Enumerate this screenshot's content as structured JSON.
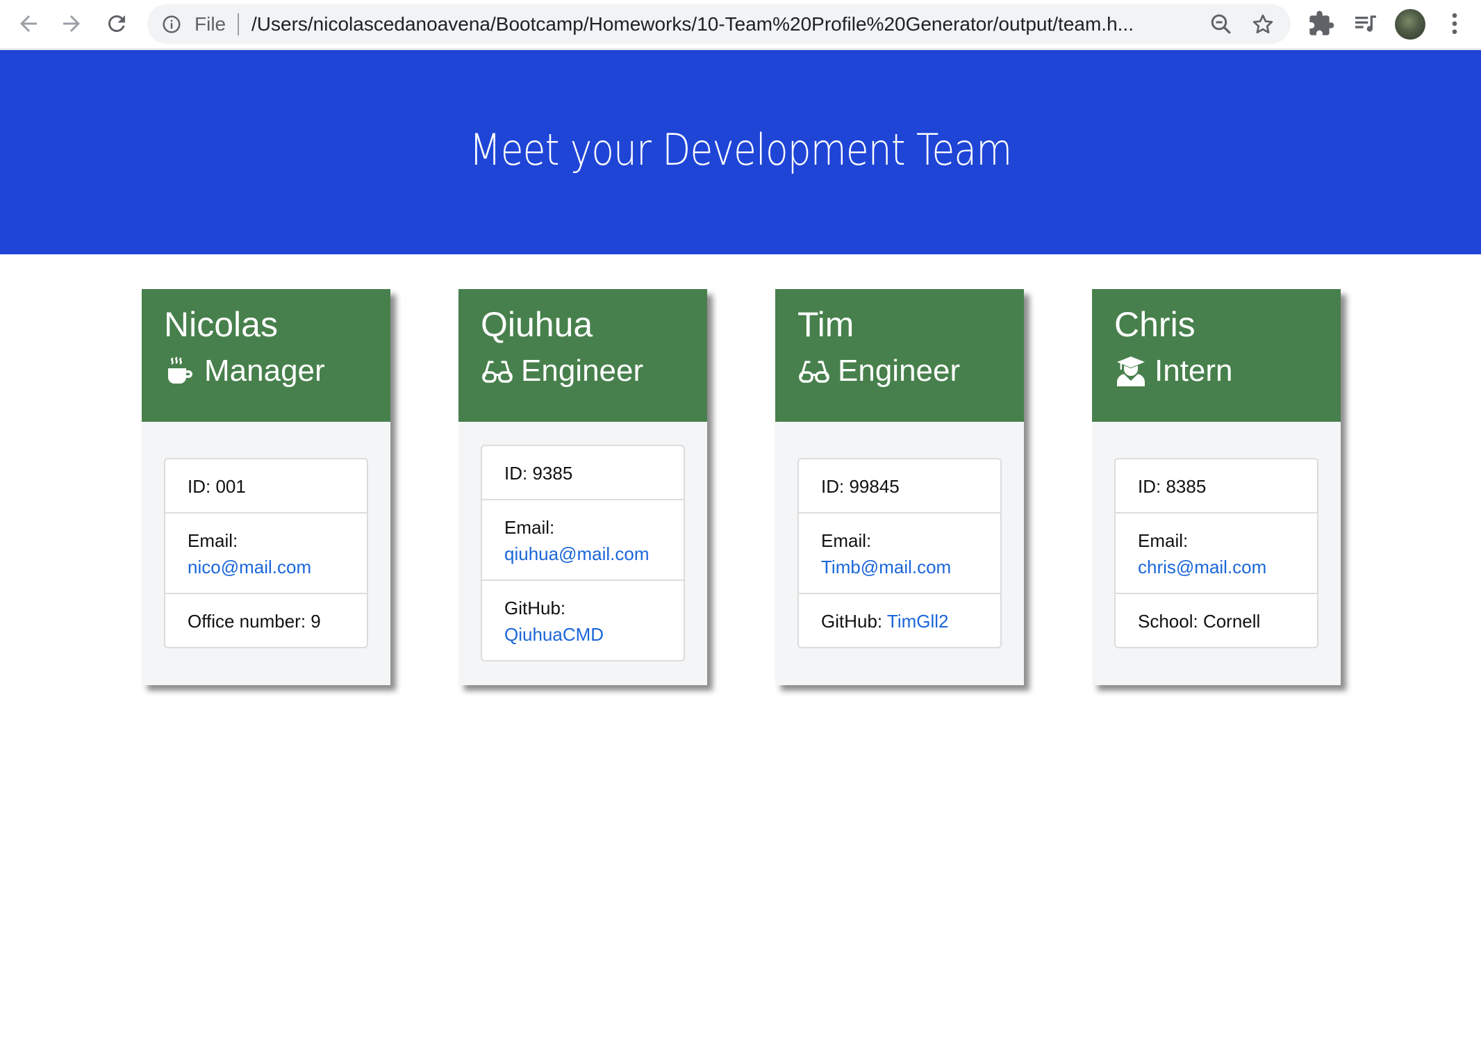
{
  "browser": {
    "scheme_label": "File",
    "url": "/Users/nicolascedanoavena/Bootcamp/Homeworks/10-Team%20Profile%20Generator/output/team.h..."
  },
  "page": {
    "title": "Meet your Development Team",
    "header_color": "#1f45d6",
    "card_header_color": "#47804c",
    "link_color": "#1a66d9"
  },
  "team": [
    {
      "name": "Nicolas",
      "role": "Manager",
      "icon": "coffee-icon",
      "id_text": "ID: 001",
      "email_label": "Email:",
      "email": "nico@mail.com",
      "extra_label": "Office number: 9",
      "extra_value": ""
    },
    {
      "name": "Qiuhua",
      "role": "Engineer",
      "icon": "glasses-icon",
      "id_text": "ID: 9385",
      "email_label": "Email:",
      "email": "qiuhua@mail.com",
      "extra_label": "GitHub:",
      "extra_value": "QiuhuaCMD"
    },
    {
      "name": "Tim",
      "role": "Engineer",
      "icon": "glasses-icon",
      "id_text": "ID: 99845",
      "email_label": "Email:",
      "email": "Timb@mail.com",
      "extra_label": "GitHub:",
      "extra_value": "TimGll2"
    },
    {
      "name": "Chris",
      "role": "Intern",
      "icon": "graduate-icon",
      "id_text": "ID: 8385",
      "email_label": "Email:",
      "email": "chris@mail.com",
      "extra_label": "School: Cornell",
      "extra_value": ""
    }
  ]
}
